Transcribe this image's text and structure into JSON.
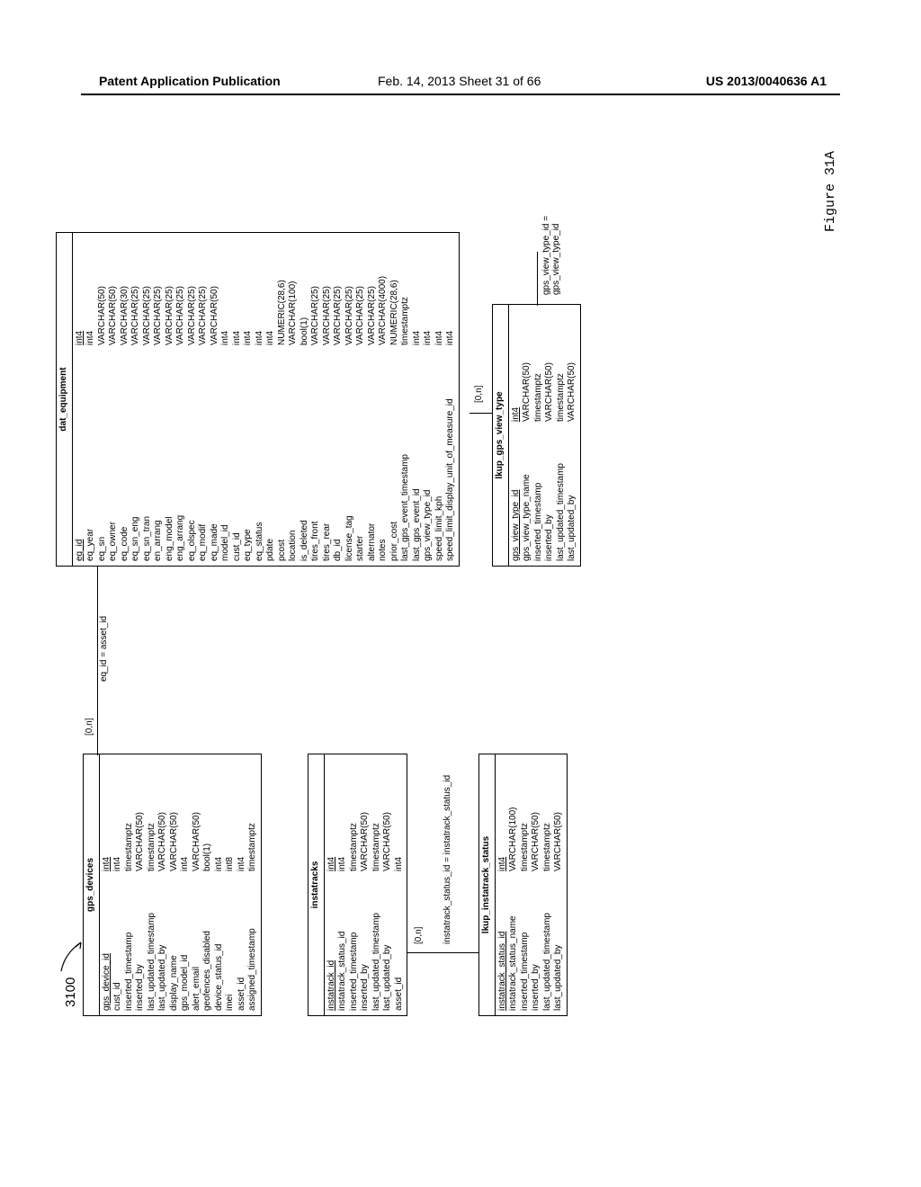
{
  "header": {
    "left": "Patent Application Publication",
    "center": "Feb. 14, 2013  Sheet 31 of 66",
    "right": "US 2013/0040636 A1"
  },
  "ref_number": "3100",
  "figure_caption": "Figure 31A",
  "relations": {
    "gps_to_dat": {
      "card": "[0,n]",
      "join": "eq_id = asset_id"
    },
    "instatracks_to_lkup": {
      "card": "[0,n]",
      "join": "instatrack_status_id = instatrack_status_id"
    },
    "dat_to_view": {
      "card": "[0,n]",
      "join": "gps_view_type_id = gps_view_type_id"
    }
  },
  "tables": {
    "gps_devices": {
      "title": "gps_devices",
      "rows": [
        {
          "name": "gps_device_id",
          "type": "int4",
          "pk": true
        },
        {
          "name": "cust_id",
          "type": "int4"
        },
        {
          "name": "inserted_timestamp",
          "type": "timestamptz"
        },
        {
          "name": "inserted_by",
          "type": "VARCHAR(50)"
        },
        {
          "name": "last_updated_timestamp",
          "type": "timestamptz"
        },
        {
          "name": "last_updated_by",
          "type": "VARCHAR(50)"
        },
        {
          "name": "display_name",
          "type": "VARCHAR(50)"
        },
        {
          "name": "gps_model_id",
          "type": "int4"
        },
        {
          "name": "alert_email",
          "type": "VARCHAR(50)"
        },
        {
          "name": "geofences_disabled",
          "type": "bool(1)"
        },
        {
          "name": "device_status_id",
          "type": "int4"
        },
        {
          "name": "imei",
          "type": "int8"
        },
        {
          "name": "asset_id",
          "type": "int4"
        },
        {
          "name": "assigned_timestamp",
          "type": "timestamptz"
        }
      ]
    },
    "instatracks": {
      "title": "instatracks",
      "rows": [
        {
          "name": "instatrack_id",
          "type": "int4",
          "pk": true
        },
        {
          "name": "instatrack_status_id",
          "type": "int4"
        },
        {
          "name": "inserted_timestamp",
          "type": "timestamptz"
        },
        {
          "name": "inserted_by",
          "type": "VARCHAR(50)"
        },
        {
          "name": "last_updated_timestamp",
          "type": "timestamptz"
        },
        {
          "name": "last_updated_by",
          "type": "VARCHAR(50)"
        },
        {
          "name": "asset_id",
          "type": "int4"
        }
      ]
    },
    "lkup_instatrack_status": {
      "title": "lkup_instatrack_status",
      "rows": [
        {
          "name": "instatrack_status_id",
          "type": "int4",
          "pk": true
        },
        {
          "name": "instatrack_status_name",
          "type": "VARCHAR(100)"
        },
        {
          "name": "inserted_timestamp",
          "type": "timestamptz"
        },
        {
          "name": "inserted_by",
          "type": "VARCHAR(50)"
        },
        {
          "name": "last_updated_timestamp",
          "type": "timestamptz"
        },
        {
          "name": "last_updated_by",
          "type": "VARCHAR(50)"
        }
      ]
    },
    "dat_equipment": {
      "title": "dat_equipment",
      "rows": [
        {
          "name": "eq_id",
          "type": "int4",
          "pk": true
        },
        {
          "name": "eq_year",
          "type": "int4"
        },
        {
          "name": "eq_sn",
          "type": "VARCHAR(50)"
        },
        {
          "name": "eq_owner",
          "type": "VARCHAR(50)"
        },
        {
          "name": "eq_code",
          "type": "VARCHAR(30)"
        },
        {
          "name": "eq_sn_eng",
          "type": "VARCHAR(25)"
        },
        {
          "name": "eq_sn_tran",
          "type": "VARCHAR(25)"
        },
        {
          "name": "en_arrang",
          "type": "VARCHAR(25)"
        },
        {
          "name": "eng_model",
          "type": "VARCHAR(25)"
        },
        {
          "name": "eng_arrang",
          "type": "VARCHAR(25)"
        },
        {
          "name": "eq_olspec",
          "type": "VARCHAR(25)"
        },
        {
          "name": "eq_modif",
          "type": "VARCHAR(25)"
        },
        {
          "name": "eq_made",
          "type": "VARCHAR(50)"
        },
        {
          "name": "model_id",
          "type": "int4"
        },
        {
          "name": "cust_id",
          "type": "int4"
        },
        {
          "name": "eq_type",
          "type": "int4"
        },
        {
          "name": "eq_status",
          "type": "int4"
        },
        {
          "name": "pdate",
          "type": "int4"
        },
        {
          "name": "pcost",
          "type": "NUMERIC(28,6)"
        },
        {
          "name": "location",
          "type": "VARCHAR(100)"
        },
        {
          "name": "is_deleted",
          "type": "bool(1)"
        },
        {
          "name": "tires_front",
          "type": "VARCHAR(25)"
        },
        {
          "name": "tires_rear",
          "type": "VARCHAR(25)"
        },
        {
          "name": "db_id",
          "type": "VARCHAR(25)"
        },
        {
          "name": "license_tag",
          "type": "VARCHAR(25)"
        },
        {
          "name": "starter",
          "type": "VARCHAR(25)"
        },
        {
          "name": "alternator",
          "type": "VARCHAR(25)"
        },
        {
          "name": "notes",
          "type": "VARCHAR(4000)"
        },
        {
          "name": "prior_cost",
          "type": "NUMERIC(28,6)"
        },
        {
          "name": "last_gps_event_timestamp",
          "type": "timestamptz"
        },
        {
          "name": "last_gps_event_id",
          "type": "int4"
        },
        {
          "name": "gps_view_type_id",
          "type": "int4"
        },
        {
          "name": "speed_limit_kph",
          "type": "int4"
        },
        {
          "name": "speed_limit_display_unit_of_measure_id",
          "type": "int4"
        }
      ]
    },
    "lkup_gps_view_type": {
      "title": "lkup_gps_view_type",
      "rows": [
        {
          "name": "gps_view_type_id",
          "type": "int4",
          "pk": true
        },
        {
          "name": "gps_view_type_name",
          "type": "VARCHAR(50)"
        },
        {
          "name": "inserted_timestamp",
          "type": "timestamptz"
        },
        {
          "name": "inserted_by",
          "type": "VARCHAR(50)"
        },
        {
          "name": "last_updated_timestamp",
          "type": "timestamptz"
        },
        {
          "name": "last_updated_by",
          "type": "VARCHAR(50)"
        }
      ]
    }
  }
}
